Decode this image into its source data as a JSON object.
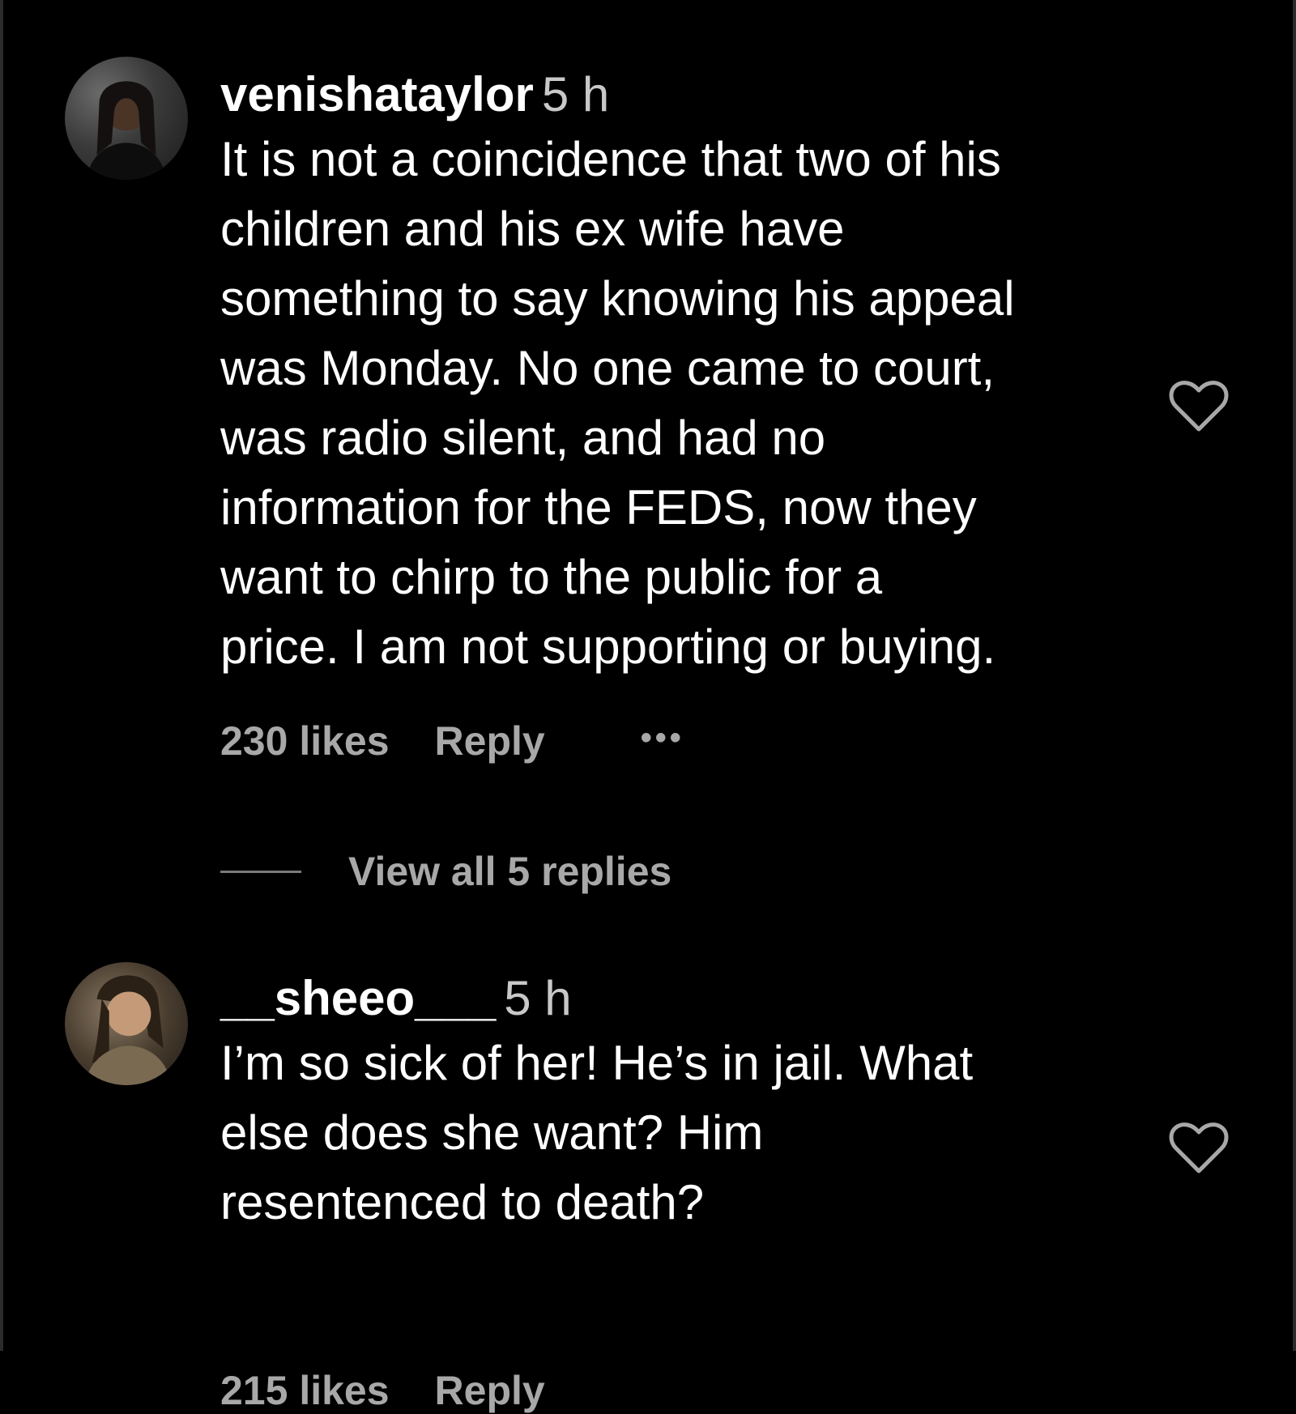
{
  "comments": [
    {
      "username": "venishataylor",
      "time": "5 h",
      "text_lines": [
        "It is not a coincidence that two of his",
        "children and his ex wife have",
        "something to say knowing his appeal",
        "was Monday. No one came to court,",
        "was radio silent, and had no",
        "information for the FEDS, now they",
        "want to chirp to the public for a",
        "price. I am not supporting or buying."
      ],
      "likes": "230 likes",
      "reply_label": "Reply",
      "more_label": "•••",
      "view_replies_label": "View all 5 replies"
    },
    {
      "username": "__sheeo___",
      "time": "5 h",
      "text_lines": [
        "I’m so sick of her! He’s in jail. What",
        "else does she want? Him",
        "resentenced to death?"
      ],
      "likes": "215 likes",
      "reply_label": "Reply"
    }
  ],
  "icons": {
    "like": "heart-outline-icon",
    "avatar": "profile-photo"
  },
  "colors": {
    "background": "#000000",
    "primary_text": "#ffffff",
    "secondary_text": "#a8a8a8"
  }
}
